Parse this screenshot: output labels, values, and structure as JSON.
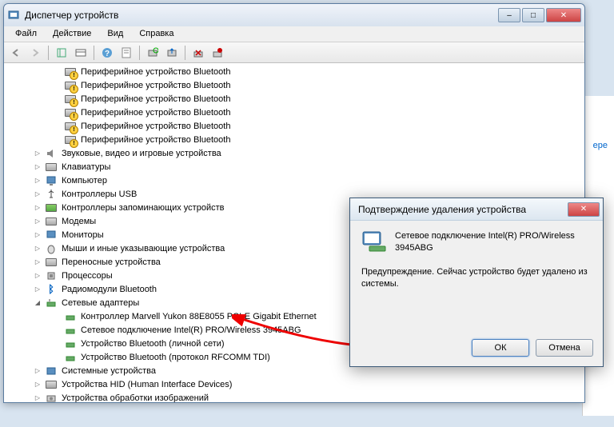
{
  "window": {
    "title": "Диспетчер устройств"
  },
  "menu": {
    "file": "Файл",
    "action": "Действие",
    "view": "Вид",
    "help": "Справка"
  },
  "tree": {
    "bt_periph": "Периферийное устройство Bluetooth",
    "sound": "Звуковые, видео и игровые устройства",
    "keyboard": "Клавиатуры",
    "computer": "Компьютер",
    "usb": "Контроллеры USB",
    "storage": "Контроллеры запоминающих устройств",
    "modems": "Модемы",
    "monitors": "Мониторы",
    "mice": "Мыши и иные указывающие устройства",
    "portable": "Переносные устройства",
    "cpu": "Процессоры",
    "bt_radio": "Радиомодули Bluetooth",
    "network": "Сетевые адаптеры",
    "net_marvell": "Контроллер Marvell Yukon 88E8055 PCI-E Gigabit Ethernet",
    "net_intel": "Сетевое подключение Intel(R) PRO/Wireless 3945ABG",
    "net_bt_pan": "Устройство Bluetooth (личной сети)",
    "net_bt_rfcomm": "Устройство Bluetooth (протокол RFCOMM TDI)",
    "system": "Системные устройства",
    "hid": "Устройства HID (Human Interface Devices)",
    "imaging": "Устройства обработки изображений"
  },
  "dialog": {
    "title": "Подтверждение удаления устройства",
    "device": "Сетевое подключение Intel(R) PRO/Wireless 3945ABG",
    "warning": "Предупреждение. Сейчас устройство будет удалено из системы.",
    "ok": "ОК",
    "cancel": "Отмена"
  },
  "bg_link": "ере"
}
